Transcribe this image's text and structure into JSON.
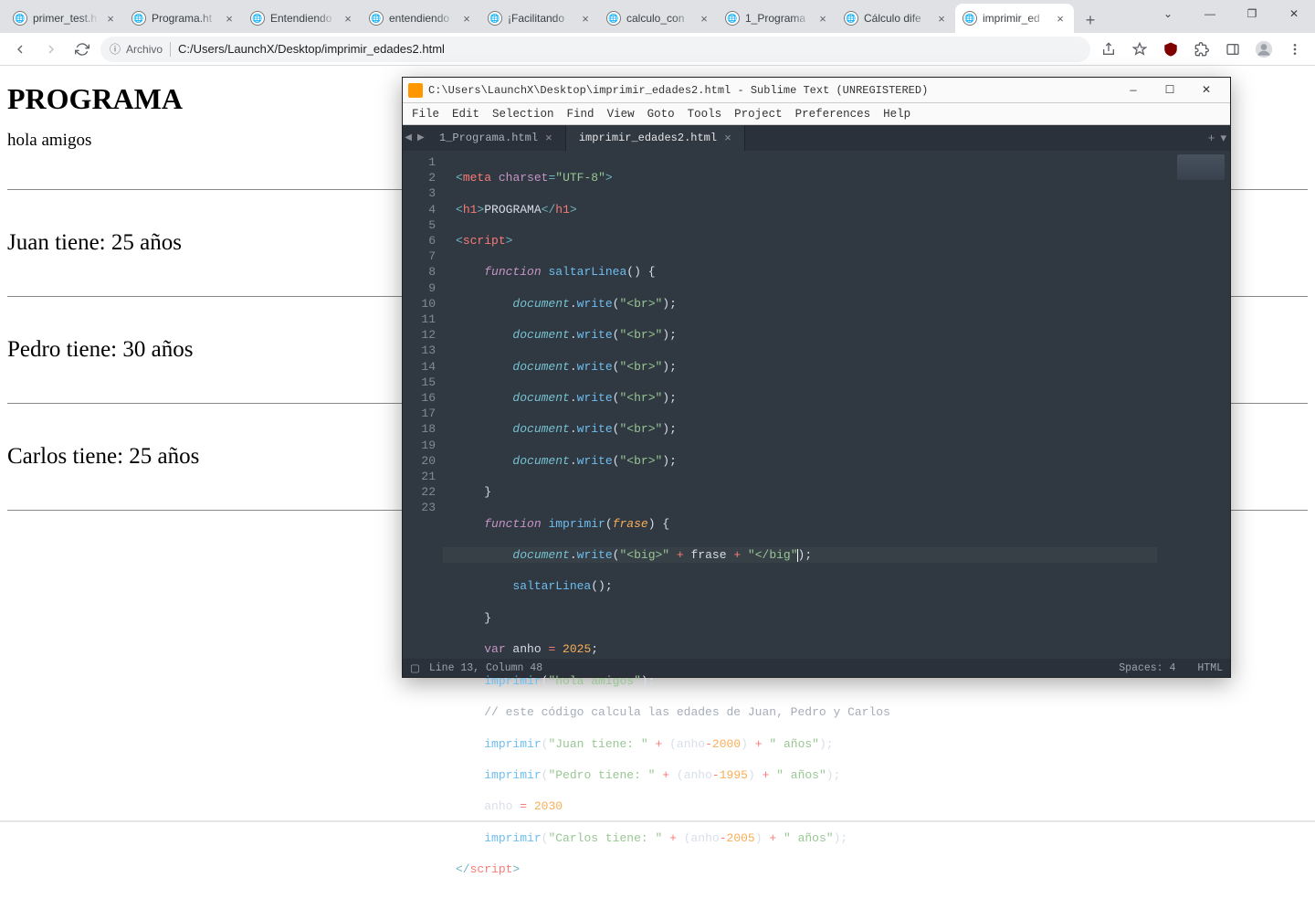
{
  "browser": {
    "tabs": [
      {
        "title": "primer_test.h"
      },
      {
        "title": "Programa.ht"
      },
      {
        "title": "Entendiendo"
      },
      {
        "title": "entendiendo"
      },
      {
        "title": "¡Facilitando"
      },
      {
        "title": "calculo_con"
      },
      {
        "title": "1_Programa"
      },
      {
        "title": "Cálculo dife"
      },
      {
        "title": "imprimir_ed"
      }
    ],
    "active_tab_index": 8,
    "omnibox": {
      "site_info_icon": "ⓘ",
      "site_info_label": "Archivo",
      "url": "C:/Users/LaunchX/Desktop/imprimir_edades2.html"
    }
  },
  "page": {
    "heading": "PROGRAMA",
    "lines": [
      "hola amigos",
      "Juan tiene: 25 años",
      "Pedro tiene: 30 años",
      "Carlos tiene: 25 años"
    ]
  },
  "sublime": {
    "title": "C:\\Users\\LaunchX\\Desktop\\imprimir_edades2.html - Sublime Text (UNREGISTERED)",
    "menu": [
      "File",
      "Edit",
      "Selection",
      "Find",
      "View",
      "Goto",
      "Tools",
      "Project",
      "Preferences",
      "Help"
    ],
    "tabs": [
      {
        "label": "1_Programa.html",
        "active": false
      },
      {
        "label": "imprimir_edades2.html",
        "active": true
      }
    ],
    "line_numbers": [
      "1",
      "2",
      "3",
      "4",
      "5",
      "6",
      "7",
      "8",
      "9",
      "10",
      "11",
      "12",
      "13",
      "14",
      "15",
      "16",
      "17",
      "18",
      "19",
      "20",
      "21",
      "22",
      "23"
    ],
    "status": {
      "cursor": "Line 13, Column 48",
      "spaces": "Spaces: 4",
      "syntax": "HTML"
    },
    "code": {
      "l1_meta_open": "<",
      "l1_meta": "meta",
      "l1_sp": " ",
      "l1_charset": "charset",
      "l1_eq": "=",
      "l1_q": "\"UTF-8\"",
      "l1_close": ">",
      "l2_open": "<",
      "l2_h1": "h1",
      "l2_gt": ">",
      "l2_txt": "PROGRAMA",
      "l2_open2": "</",
      "l2_h1b": "h1",
      "l2_gt2": ">",
      "l3_open": "<",
      "l3_s": "script",
      "l3_gt": ">",
      "l4_kw": "function",
      "l4_sp": " ",
      "l4_fn": "saltarLinea",
      "l4_paren": "()",
      "l4_sp2": " ",
      "l4_brace": "{",
      "dw_obj": "document",
      "dw_dot": ".",
      "dw_m": "write",
      "dw_o": "(",
      "dw_br": "\"<br>\"",
      "dw_hr": "\"<hr>\"",
      "dw_c": ")",
      "dw_semi": ";",
      "l11_brace": "}",
      "l12_kw": "function",
      "l12_fn": "imprimir",
      "l12_o": "(",
      "l12_p": "frase",
      "l12_c": ")",
      "l12_brace": " {",
      "l13_s1": "\"<big>\"",
      "l13_plus": " + ",
      "l13_var": "frase",
      "l13_s2": "\"</big\"",
      "l13_close": ");",
      "l14_fn": "saltarLinea",
      "l14_call": "();",
      "l15_brace": "}",
      "l16_var": "var",
      "l16_name": " anho ",
      "l16_eq": "=",
      "l16_val": " 2025",
      "l16_semi": ";",
      "l17_fn": "imprimir",
      "l17_o": "(",
      "l17_s": "\"hola amigos\"",
      "l17_c": ");",
      "l18": "// este código calcula las edades de Juan, Pedro y Carlos",
      "l19_fn": "imprimir",
      "l19_s1": "\"Juan tiene: \"",
      "l19_plus": " + ",
      "l19_o": "(",
      "l19_a": "anho",
      "l19_m": "-",
      "l19_n": "2000",
      "l19_c": ")",
      "l19_s2": "\" años\"",
      "l19_end": ");",
      "l20_fn": "imprimir",
      "l20_s1": "\"Pedro tiene: \"",
      "l20_n": "1995",
      "l20_s2": "\" años\"",
      "l21_a": "anho ",
      "l21_eq": "=",
      "l21_n": " 2030",
      "l22_fn": "imprimir",
      "l22_s1": "\"Carlos tiene: \"",
      "l22_n": "2005",
      "l22_s2": "\" años\"",
      "l23_open": "</",
      "l23_s": "script",
      "l23_gt": ">"
    }
  }
}
